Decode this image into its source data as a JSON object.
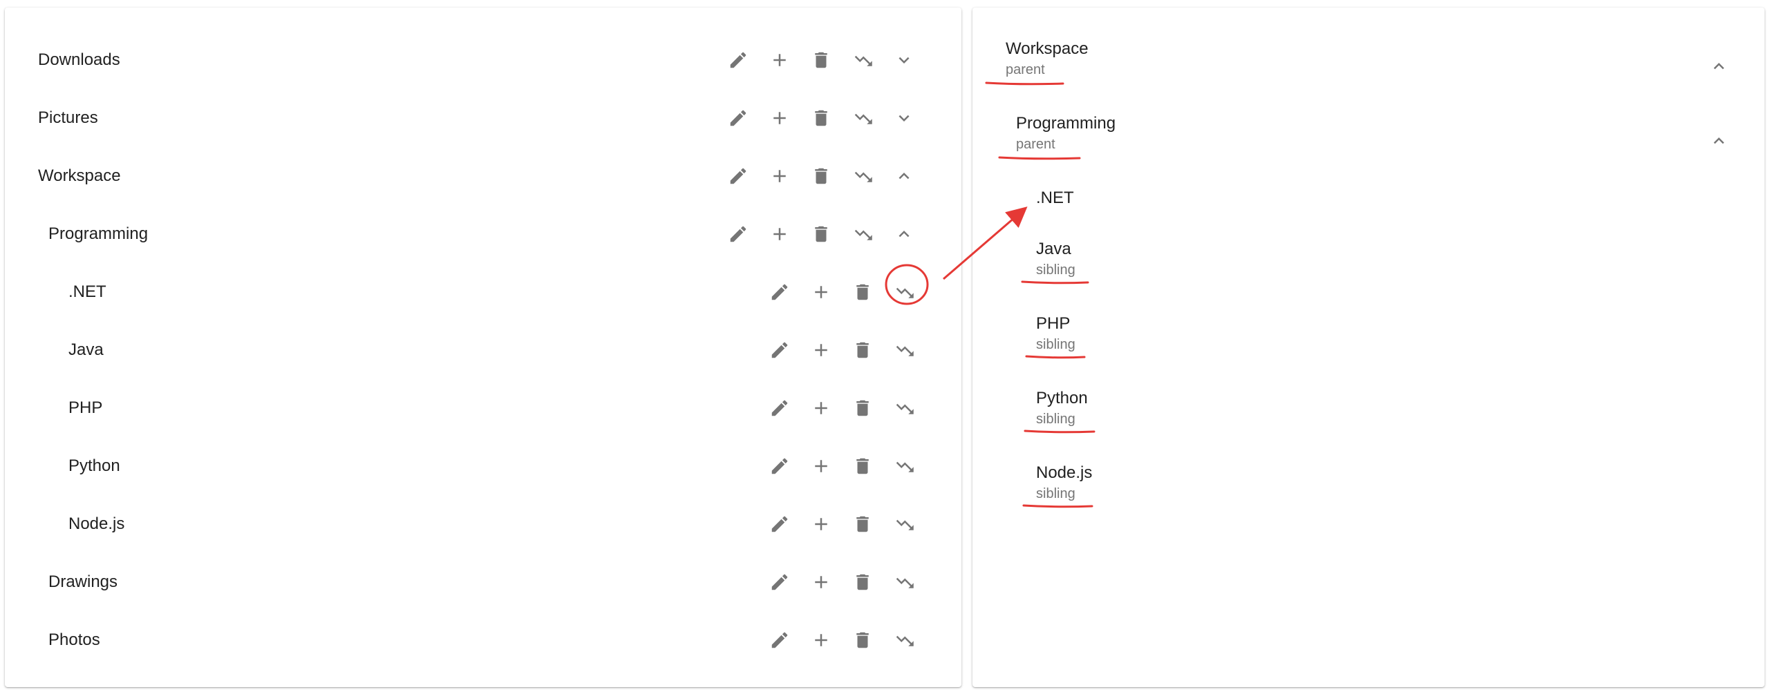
{
  "tree": {
    "items": [
      {
        "label": "Downloads",
        "expanded": false
      },
      {
        "label": "Pictures",
        "expanded": false
      },
      {
        "label": "Workspace",
        "expanded": true
      },
      {
        "label": "Programming",
        "expanded": true
      },
      {
        "label": ".NET"
      },
      {
        "label": "Java"
      },
      {
        "label": "PHP"
      },
      {
        "label": "Python"
      },
      {
        "label": "Node.js"
      },
      {
        "label": "Drawings"
      },
      {
        "label": "Photos"
      }
    ],
    "action_icons": [
      "pencil-icon",
      "plus-icon",
      "trash-icon",
      "move-icon",
      "chevron-icon"
    ]
  },
  "move_panel": {
    "items": [
      {
        "title": "Workspace",
        "subtitle": "parent"
      },
      {
        "title": "Programming",
        "subtitle": "parent"
      },
      {
        "title": ".NET",
        "subtitle": ""
      },
      {
        "title": "Java",
        "subtitle": "sibling"
      },
      {
        "title": "PHP",
        "subtitle": "sibling"
      },
      {
        "title": "Python",
        "subtitle": "sibling"
      },
      {
        "title": "Node.js",
        "subtitle": "sibling"
      }
    ]
  },
  "colors": {
    "icon": "#757575",
    "text": "#212121",
    "subtext": "#757575",
    "annotation": "#e53935"
  }
}
